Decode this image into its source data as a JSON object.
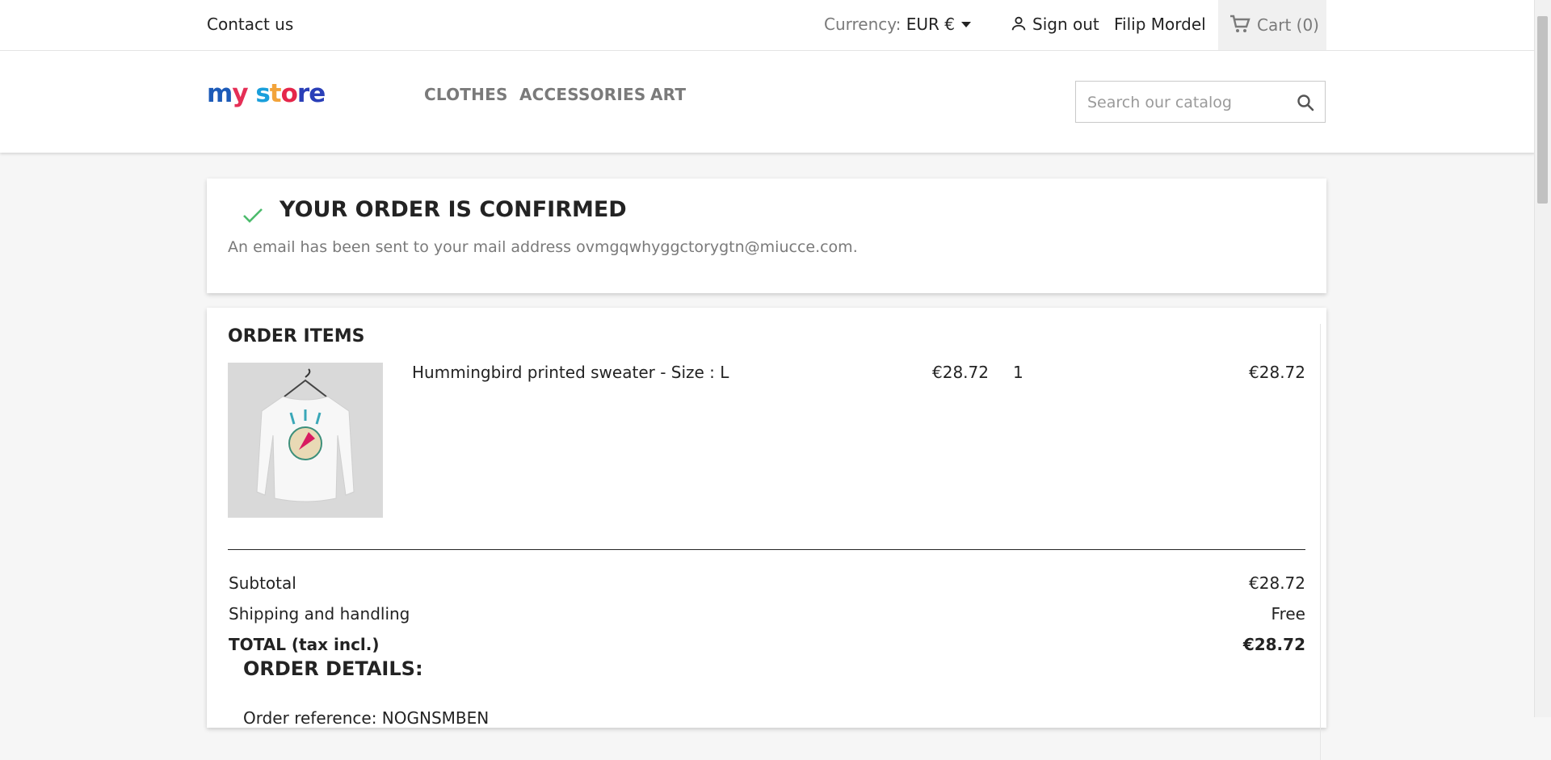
{
  "topbar": {
    "contact_label": "Contact us",
    "currency_label": "Currency:",
    "currency_value": "EUR €",
    "signout_label": "Sign out",
    "user_name": "Filip Mordel",
    "cart_label": "Cart (0)"
  },
  "header": {
    "logo_parts": [
      "m",
      "y",
      " s",
      "t",
      "o",
      "re"
    ],
    "nav": [
      "CLOTHES",
      "ACCESSORIES",
      "ART"
    ],
    "search_placeholder": "Search our catalog"
  },
  "confirmation": {
    "title": "YOUR ORDER IS CONFIRMED",
    "email_text": "An email has been sent to your mail address ovmgqwhyggctorygtn@miucce.com."
  },
  "order_items": {
    "title": "ORDER ITEMS",
    "items": [
      {
        "name": "Hummingbird printed sweater - Size : L",
        "unit_price": "€28.72",
        "quantity": "1",
        "total": "€28.72"
      }
    ],
    "subtotal_label": "Subtotal",
    "subtotal_value": "€28.72",
    "shipping_label": "Shipping and handling",
    "shipping_value": "Free",
    "total_label": "TOTAL (tax incl.)",
    "total_value": "€28.72"
  },
  "order_details": {
    "title": "ORDER DETAILS:",
    "reference": "Order reference: NOGNSMBEN"
  },
  "colors": {
    "accent_green": "#4cbb6c",
    "text_dark": "#232323",
    "text_muted": "#7a7a7a"
  }
}
